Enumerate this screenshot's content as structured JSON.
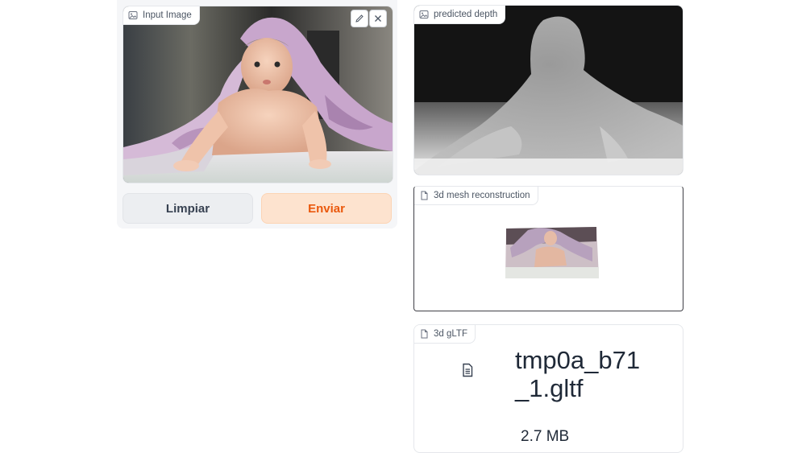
{
  "input_panel": {
    "label": "Input Image",
    "icon": "image-icon",
    "tools": [
      "edit-icon",
      "close-icon"
    ]
  },
  "buttons": {
    "clear_label": "Limpiar",
    "submit_label": "Enviar"
  },
  "depth_panel": {
    "label": "predicted depth",
    "icon": "image-icon"
  },
  "mesh_panel": {
    "label": "3d mesh reconstruction",
    "icon": "file-icon"
  },
  "gltf_panel": {
    "label": "3d gLTF",
    "icon": "file-icon",
    "file_name": "tmp0a_b71_1.gltf",
    "file_size": "2.7 MB"
  },
  "colors": {
    "accent": "#ea580c",
    "accent_bg": "#fde3cf",
    "neutral_btn": "#eceef1"
  }
}
